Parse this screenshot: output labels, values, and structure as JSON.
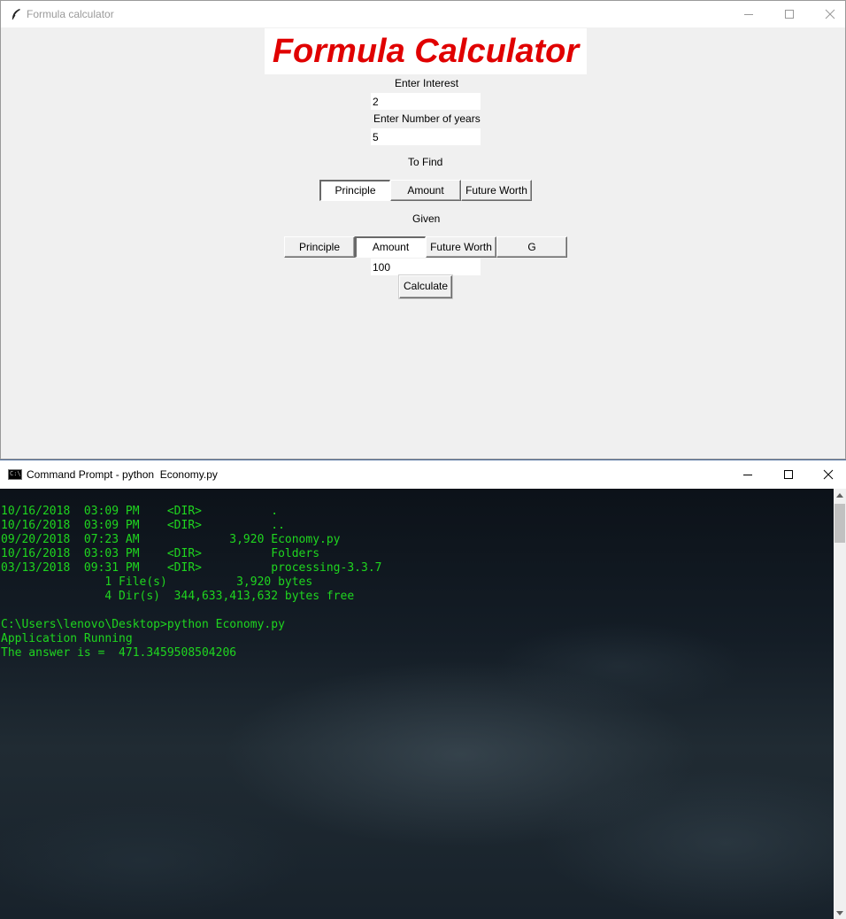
{
  "tk_window": {
    "title": "Formula calculator",
    "heading": "Formula Calculator",
    "interest_label": "Enter Interest",
    "interest_value": "2",
    "years_label": "Enter Number of years",
    "years_value": "5",
    "to_find_label": "To Find",
    "to_find_options": [
      "Principle",
      "Amount",
      "Future Worth"
    ],
    "to_find_selected": "Principle",
    "given_label": "Given",
    "given_options": [
      "Principle",
      "Amount",
      "Future Worth",
      "G"
    ],
    "given_selected": "Amount",
    "given_value": "100",
    "calculate_label": "Calculate",
    "heading_color": "#e00000"
  },
  "cmd_window": {
    "title": "Command Prompt - python  Economy.py",
    "text_color": "#1fd61f",
    "lines": [
      "10/16/2018  03:09 PM    <DIR>          .",
      "10/16/2018  03:09 PM    <DIR>          ..",
      "09/20/2018  07:23 AM             3,920 Economy.py",
      "10/16/2018  03:03 PM    <DIR>          Folders",
      "03/13/2018  09:31 PM    <DIR>          processing-3.3.7",
      "               1 File(s)          3,920 bytes",
      "               4 Dir(s)  344,633,413,632 bytes free",
      "",
      "C:\\Users\\lenovo\\Desktop>python Economy.py",
      "Application Running",
      "The answer is =  471.3459508504206"
    ]
  }
}
